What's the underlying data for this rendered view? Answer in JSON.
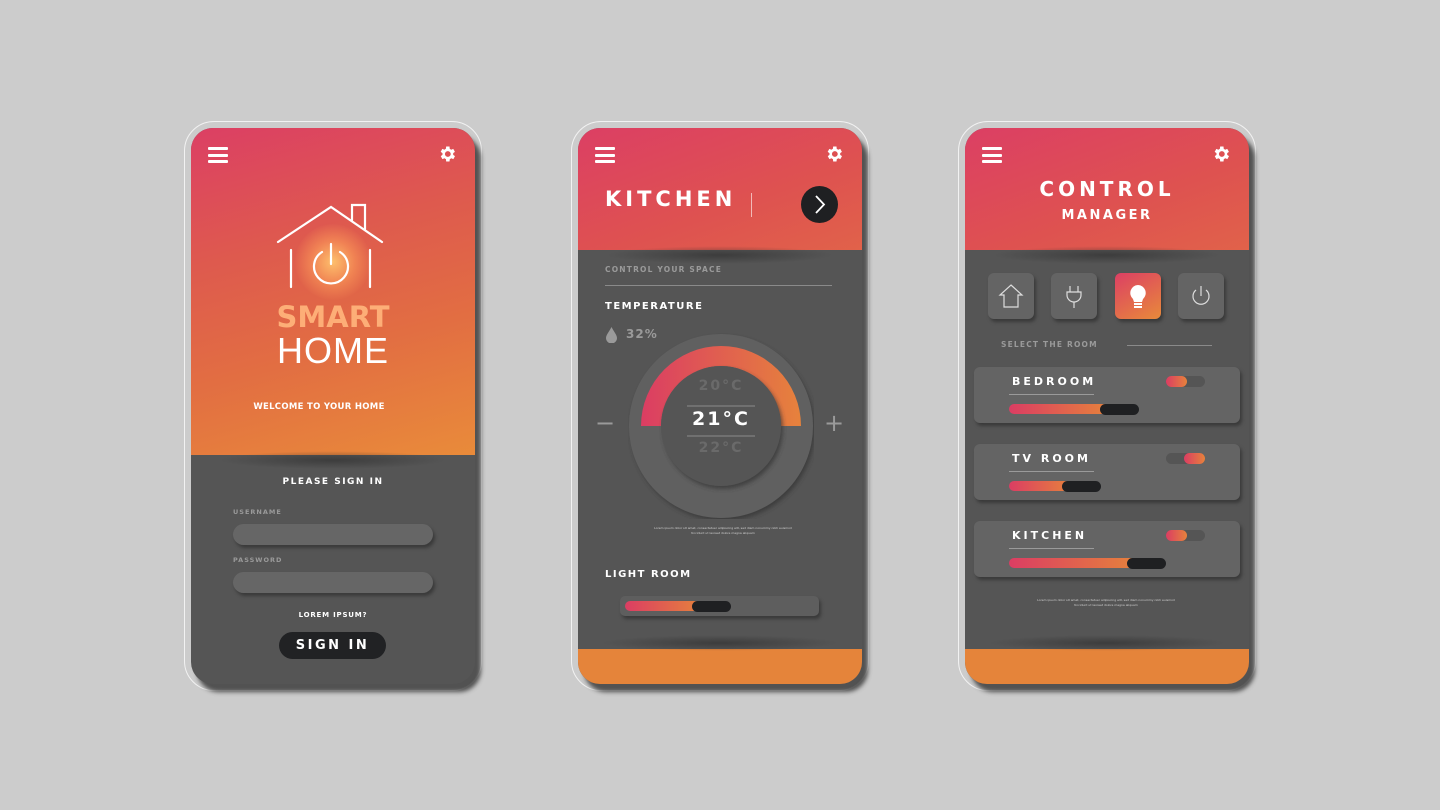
{
  "colors": {
    "background": "#cccccc",
    "screen_body": "#555555",
    "gradient_start": "#dc3f64",
    "gradient_end": "#e98b3a",
    "footer": "#e5843a",
    "dark_button": "#1f2022",
    "muted_text": "#9a9a9a",
    "brand_accent": "#fdae77"
  },
  "screens": [
    {
      "id": "login",
      "header": {
        "menu_icon": "hamburger-menu-icon",
        "settings_icon": "gear-icon"
      },
      "logo_icon": "house-power-icon",
      "brand": {
        "line1": "SMART",
        "line2": "HOME"
      },
      "welcome": "WELCOME TO YOUR HOME",
      "sign_in_title": "PLEASE SIGN IN",
      "fields": [
        {
          "label": "USERNAME",
          "value": "",
          "placeholder": ""
        },
        {
          "label": "PASSWORD",
          "value": "",
          "placeholder": ""
        }
      ],
      "help_link": "LOREM IPSUM?",
      "submit_label": "SIGN IN"
    },
    {
      "id": "room",
      "header": {
        "menu_icon": "hamburger-menu-icon",
        "settings_icon": "gear-icon",
        "next_icon": "chevron-right-icon"
      },
      "title": "KITCHEN",
      "section_label": "CONTROL YOUR SPACE",
      "temperature": {
        "label": "TEMPERATURE",
        "humidity_icon": "water-drop-icon",
        "humidity": "32%",
        "above": "20°C",
        "current": "21°C",
        "below": "22°C",
        "dial_fill_fraction": 0.5,
        "decrease_label": "−",
        "increase_label": "+"
      },
      "fine_print": "Lorem ipsum dolor sit amet, consectetuer adipiscing elit, sed diam nonummy nibh euismod tincidunt ut laoreet dolore magna aliquam",
      "light": {
        "label": "LIGHT ROOM",
        "level": 0.56
      }
    },
    {
      "id": "control",
      "header": {
        "menu_icon": "hamburger-menu-icon",
        "settings_icon": "gear-icon"
      },
      "title": "CONTROL",
      "subtitle": "MANAGER",
      "categories": [
        {
          "name": "home",
          "icon": "house-icon",
          "active": false
        },
        {
          "name": "plug",
          "icon": "plug-icon",
          "active": false
        },
        {
          "name": "light",
          "icon": "lightbulb-icon",
          "active": true
        },
        {
          "name": "power",
          "icon": "power-icon",
          "active": false
        }
      ],
      "select_label": "SELECT THE ROOM",
      "rooms": [
        {
          "name": "BEDROOM",
          "level": 0.6,
          "toggle_on": false
        },
        {
          "name": "TV ROOM",
          "level": 0.35,
          "toggle_on": true
        },
        {
          "name": "KITCHEN",
          "level": 0.78,
          "toggle_on": false
        }
      ],
      "fine_print": "Lorem ipsum dolor sit amet, consectetuer adipiscing elit, sed diam nonummy nibh euismod tincidunt ut laoreet dolore magna aliquam"
    }
  ]
}
